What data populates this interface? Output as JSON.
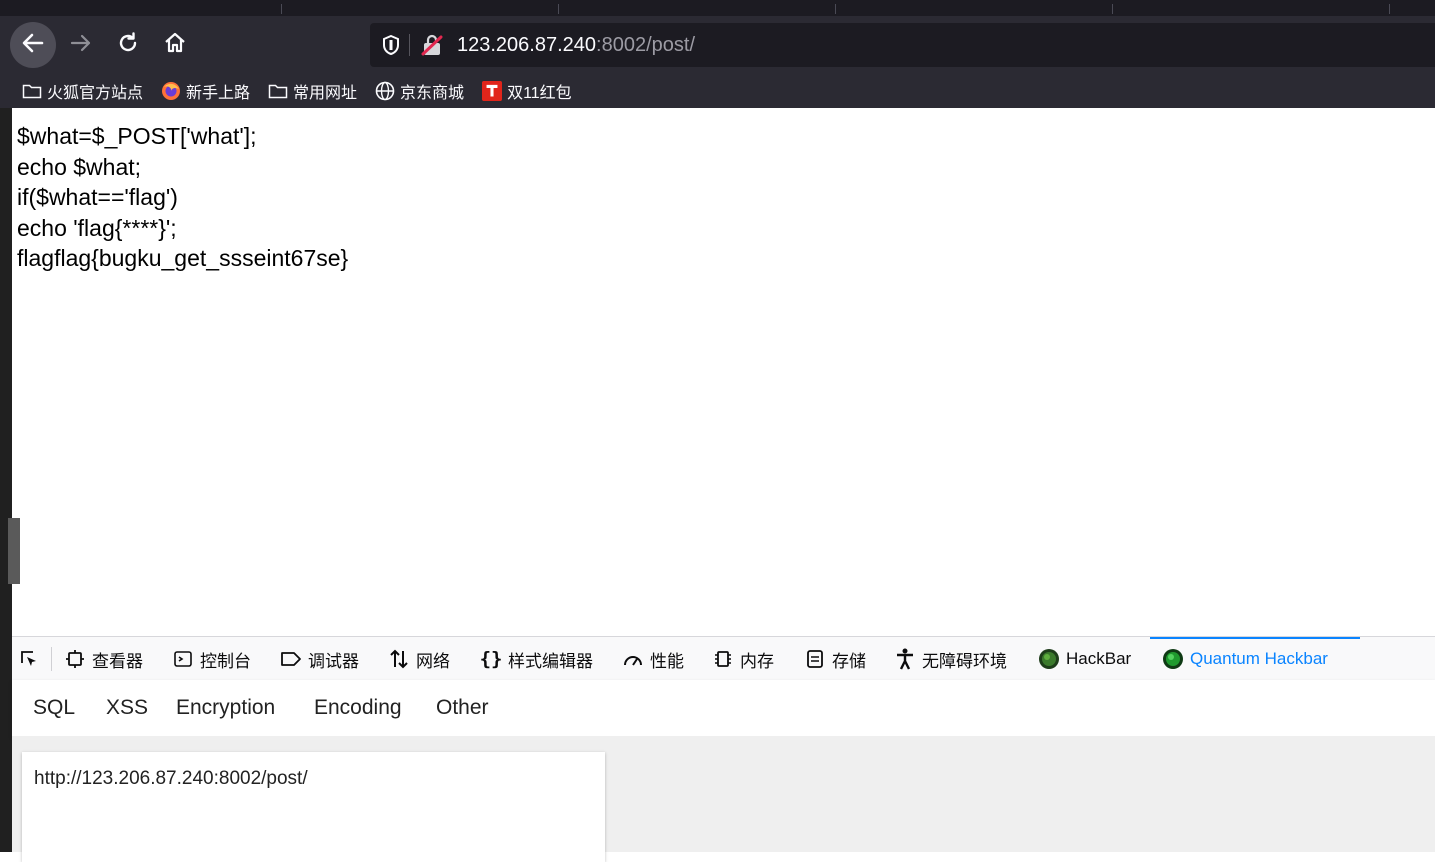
{
  "browser": {
    "url_host": "123.206.87.240",
    "url_rest": ":8002/post/",
    "icons": {
      "back": "arrow-left-icon",
      "forward": "arrow-right-icon",
      "reload": "reload-icon",
      "home": "home-icon",
      "tracking": "shield-icon",
      "insecure": "insecure-lock-icon"
    }
  },
  "bookmarks": [
    {
      "label": "火狐官方站点",
      "icon": "folder-icon"
    },
    {
      "label": "新手上路",
      "icon": "firefox-icon"
    },
    {
      "label": "常用网址",
      "icon": "folder-icon"
    },
    {
      "label": "京东商城",
      "icon": "globe-icon"
    },
    {
      "label": "双11红包",
      "icon": "t-badge-icon"
    }
  ],
  "page": {
    "lines": [
      "$what=$_POST['what'];",
      "echo $what;",
      "if($what=='flag')",
      "echo 'flag{****}';",
      "flagflag{bugku_get_ssseint67se}"
    ]
  },
  "devtools": {
    "tabs": [
      {
        "label": "查看器",
        "icon": "inspector-icon"
      },
      {
        "label": "控制台",
        "icon": "console-icon"
      },
      {
        "label": "调试器",
        "icon": "debugger-icon"
      },
      {
        "label": "网络",
        "icon": "network-icon"
      },
      {
        "label": "样式编辑器",
        "icon": "style-editor-icon"
      },
      {
        "label": "性能",
        "icon": "performance-icon"
      },
      {
        "label": "内存",
        "icon": "memory-icon"
      },
      {
        "label": "存储",
        "icon": "storage-icon"
      },
      {
        "label": "无障碍环境",
        "icon": "accessibility-icon"
      },
      {
        "label": "HackBar",
        "icon": "hackbar-icon"
      },
      {
        "label": "Quantum Hackbar",
        "icon": "quantum-hackbar-icon"
      }
    ],
    "active_tab": "Quantum Hackbar",
    "accent": "#0a84ff"
  },
  "hackbar": {
    "menu": [
      "SQL",
      "XSS",
      "Encryption",
      "Encoding",
      "Other"
    ],
    "url_value": "http://123.206.87.240:8002/post/"
  }
}
